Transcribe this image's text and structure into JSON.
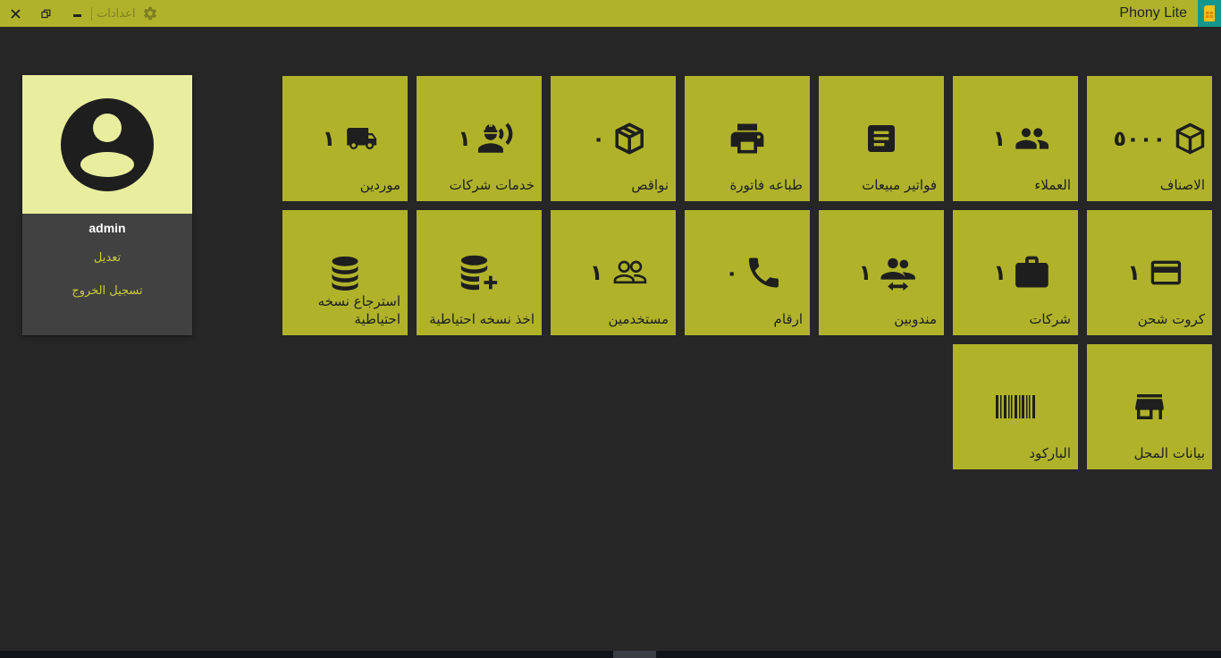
{
  "titlebar": {
    "app_title": "Phony Lite",
    "settings_label": "اعدادات"
  },
  "profile": {
    "username": "admin",
    "edit_label": "تعديل",
    "logout_label": "تسجيل الخروج"
  },
  "tiles": {
    "items_label": "الاصناف",
    "items_count": "٥٠٠٠",
    "customers_label": "العملاء",
    "customers_count": "١",
    "sales_invoices_label": "فواتير مبيعات",
    "print_invoice_label": "طباعه فاتورة",
    "shortages_label": "نواقص",
    "shortages_count": "٠",
    "company_services_label": "خدمات شركات",
    "company_services_count": "١",
    "suppliers_label": "موردين",
    "suppliers_count": "١",
    "recharge_cards_label": "كروت شحن",
    "recharge_cards_count": "١",
    "companies_label": "شركات",
    "companies_count": "١",
    "delegates_label": "مندوبين",
    "delegates_count": "١",
    "numbers_label": "ارقام",
    "numbers_count": "٠",
    "users_label": "مستخدمين",
    "users_count": "١",
    "backup_label": "اخذ نسخه احتياطية",
    "restore_label": "استرجاع نسخه احتياطية",
    "shop_data_label": "بيانات المحل",
    "barcode_label": "الباركود"
  },
  "colors": {
    "accent": "#b0b32a",
    "background": "#262626",
    "card": "#414141",
    "avatar_bg": "#e8ee9d"
  }
}
